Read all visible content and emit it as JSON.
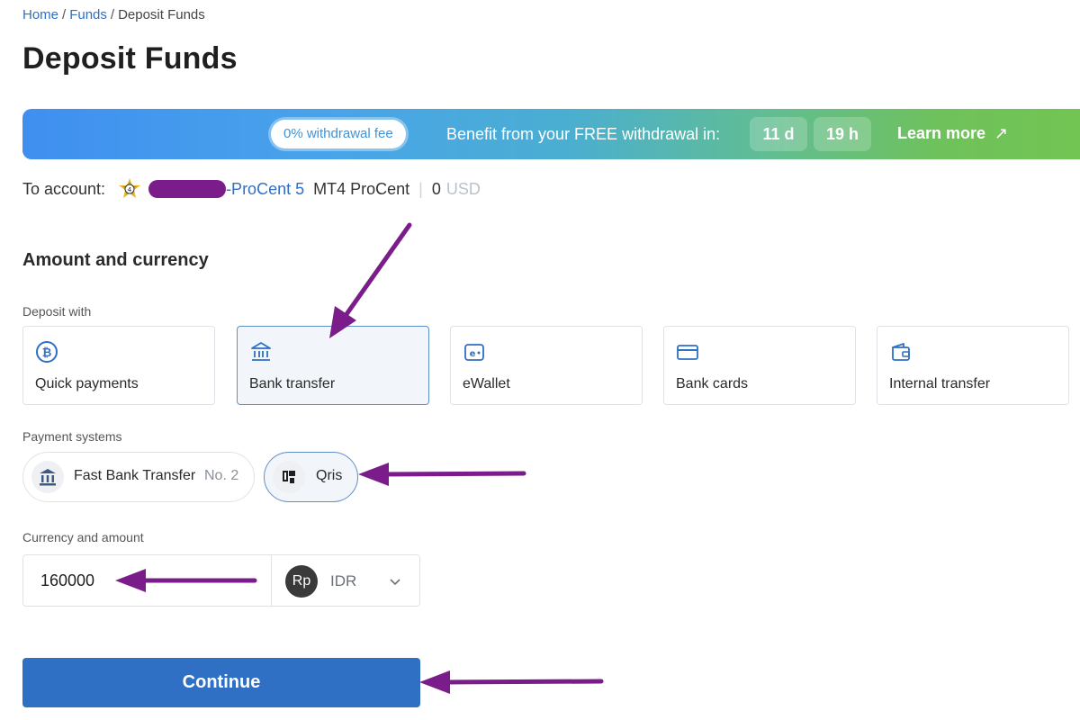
{
  "breadcrumb": {
    "items": [
      "Home",
      "Funds"
    ],
    "current": "Deposit Funds",
    "separator": "/"
  },
  "page_title": "Deposit Funds",
  "promo": {
    "pill": "0% withdrawal fee",
    "benefit_text": "Benefit from your FREE withdrawal in:",
    "days": "11 d",
    "hours": "19 h",
    "learn_more": "Learn more",
    "learn_more_icon": "arrow-up-right-icon"
  },
  "account": {
    "label": "To account:",
    "name_suffix": "-ProCent 5",
    "type": "MT4 ProCent",
    "balance": "0",
    "currency": "USD",
    "platform_icon": "mt4-icon"
  },
  "amount_section": {
    "title": "Amount and currency"
  },
  "deposit_with": {
    "label": "Deposit with",
    "methods": [
      {
        "label": "Quick payments",
        "icon": "bitcoin-icon"
      },
      {
        "label": "Bank transfer",
        "icon": "bank-icon",
        "selected": true
      },
      {
        "label": "eWallet",
        "icon": "ewallet-icon"
      },
      {
        "label": "Bank cards",
        "icon": "card-icon"
      },
      {
        "label": "Internal transfer",
        "icon": "wallet-icon"
      }
    ]
  },
  "payment_systems": {
    "label": "Payment systems",
    "items": [
      {
        "name": "Fast Bank Transfer",
        "badge": "No. 2",
        "icon": "bank-icon"
      },
      {
        "name": "Qris",
        "icon": "qris-icon",
        "selected": true
      }
    ]
  },
  "currency_amount": {
    "label": "Currency and amount",
    "amount": "160000",
    "currency_symbol": "Rp",
    "currency": "IDR"
  },
  "continue_label": "Continue",
  "colors": {
    "accent": "#2f6fc4",
    "annotation": "#7a1d8a",
    "selected_border": "#5f8fc8"
  }
}
